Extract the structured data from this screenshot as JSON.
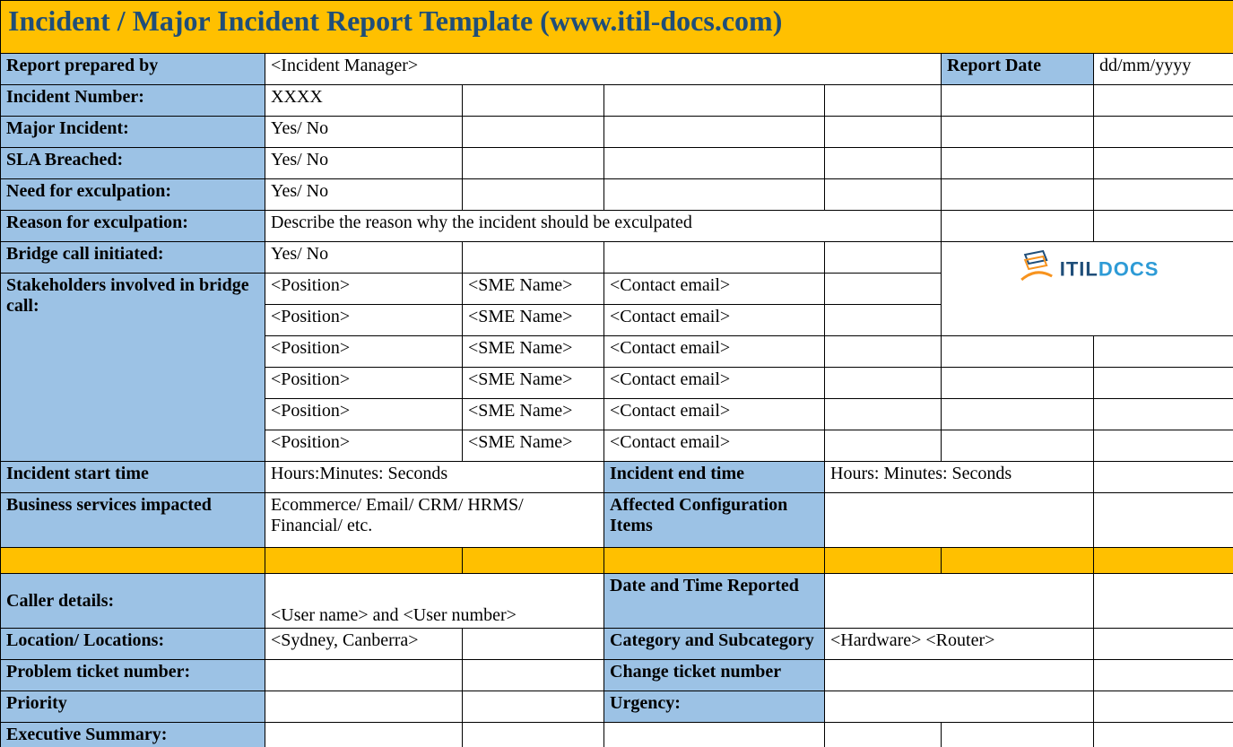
{
  "title": "Incident / Major Incident Report Template   (www.itil-docs.com)",
  "rows": {
    "report_prepared_by_label": "Report prepared by",
    "report_prepared_by_value": "<Incident Manager>",
    "report_date_label": "Report Date",
    "report_date_value": "dd/mm/yyyy",
    "incident_number_label": "Incident Number:",
    "incident_number_value": "XXXX",
    "major_incident_label": "Major Incident:",
    "major_incident_value": "Yes/ No",
    "sla_breached_label": "SLA Breached:",
    "sla_breached_value": "Yes/ No",
    "need_exculpation_label": "Need for exculpation:",
    "need_exculpation_value": "Yes/ No",
    "reason_exculpation_label": "Reason for exculpation:",
    "reason_exculpation_value": "Describe the reason why the incident should be exculpated",
    "bridge_call_label": "Bridge call initiated:",
    "bridge_call_value": "Yes/ No",
    "stakeholders_label": "Stakeholders involved in bridge call:",
    "stakeholders": [
      {
        "position": "<Position>",
        "sme": "<SME Name>",
        "email": "<Contact email>"
      },
      {
        "position": "<Position>",
        "sme": "<SME Name>",
        "email": "<Contact email>"
      },
      {
        "position": "<Position>",
        "sme": "<SME Name>",
        "email": "<Contact email>"
      },
      {
        "position": "<Position>",
        "sme": "<SME Name>",
        "email": "<Contact email>"
      },
      {
        "position": "<Position>",
        "sme": "<SME Name>",
        "email": "<Contact email>"
      },
      {
        "position": "<Position>",
        "sme": "<SME Name>",
        "email": "<Contact email>"
      }
    ],
    "incident_start_label": "Incident start time",
    "incident_start_value": "Hours:Minutes: Seconds",
    "incident_end_label": "Incident end time",
    "incident_end_value": "Hours: Minutes: Seconds",
    "business_services_label": "Business services impacted",
    "business_services_value": "Ecommerce/ Email/ CRM/ HRMS/ Financial/ etc.",
    "affected_ci_label": "Affected Configuration Items",
    "caller_details_label": "Caller details:",
    "caller_details_value": "<User name> and <User number>",
    "date_time_reported_label": "Date and Time Reported",
    "location_label": "Location/ Locations:",
    "location_value": "<Sydney, Canberra>",
    "category_label": "Category and Subcategory",
    "category_value": "<Hardware> <Router>",
    "problem_ticket_label": "Problem ticket number:",
    "change_ticket_label": "Change ticket number",
    "priority_label": "Priority",
    "urgency_label": "Urgency:",
    "executive_summary_label": "Executive Summary:"
  },
  "logo": {
    "text_itil": "ITIL",
    "text_docs": "DOCS"
  }
}
